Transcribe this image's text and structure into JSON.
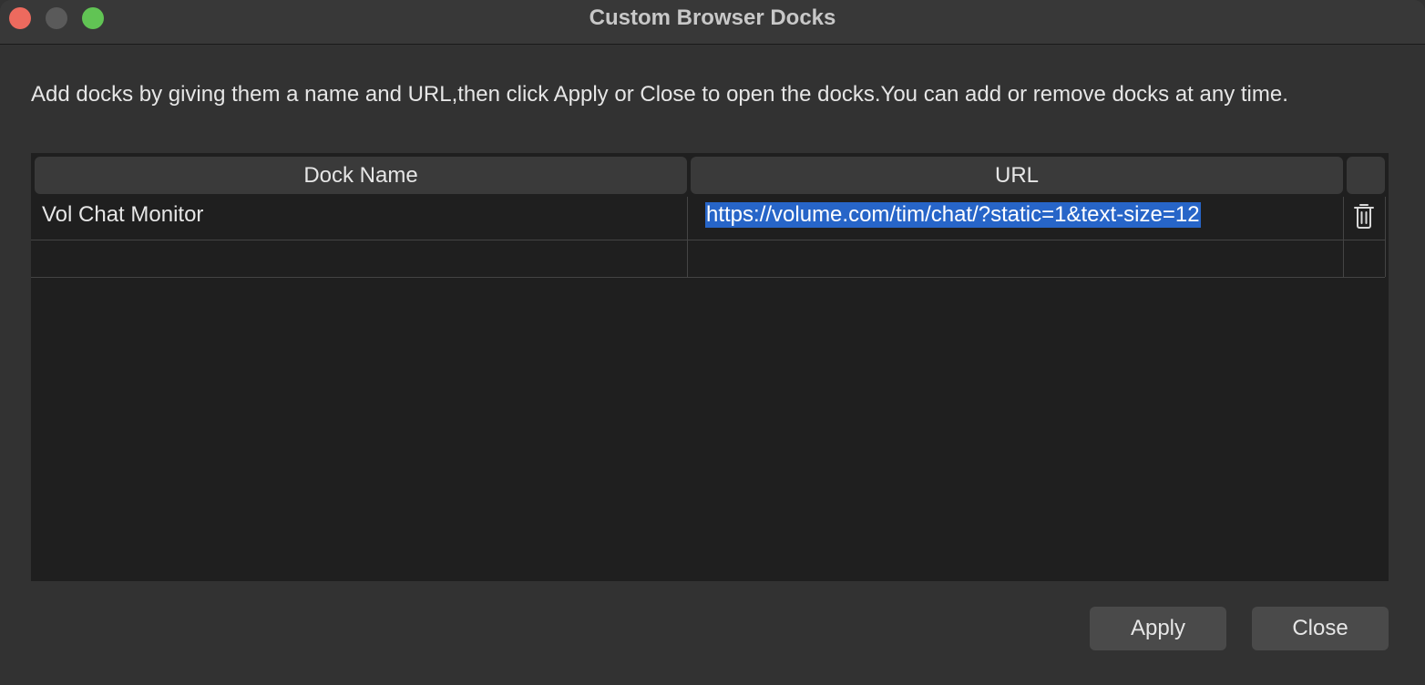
{
  "window": {
    "title": "Custom Browser Docks"
  },
  "description": "Add docks by giving them a name and URL,then click Apply or Close to open the docks.You can add or remove docks at any time.",
  "table": {
    "columns": [
      "Dock Name",
      "URL"
    ],
    "rows": [
      {
        "name": "Vol Chat Monitor",
        "url": "https://volume.com/tim/chat/?static=1&text-size=12",
        "action_icon": "trash-icon"
      },
      {
        "name": "",
        "url": "",
        "action_icon": ""
      }
    ]
  },
  "buttons": {
    "apply_label": "Apply",
    "close_label": "Close"
  },
  "colors": {
    "selection": "#2765c8",
    "close_light": "#ed6a5e",
    "maximize_light": "#61c454"
  }
}
